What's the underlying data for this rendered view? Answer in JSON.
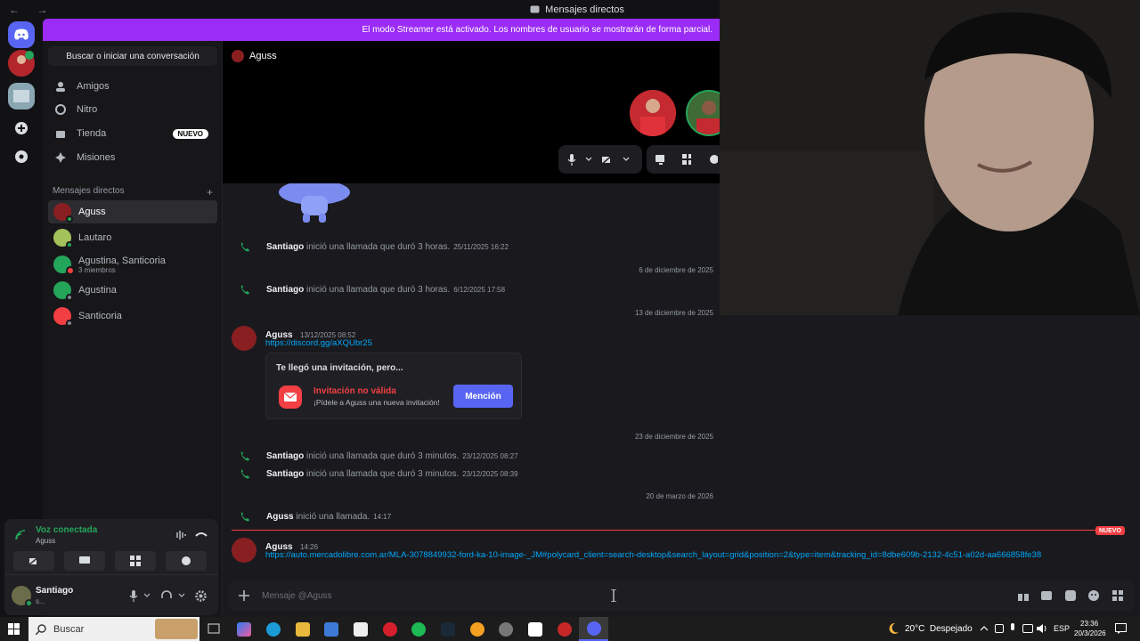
{
  "titlebar": {
    "nav": "← →",
    "title": "Mensajes directos"
  },
  "banner": {
    "text": "El modo Streamer está activado. Los nombres de usuario se mostrarán de forma parcial."
  },
  "sidebar": {
    "search_label": "Buscar o iniciar una conversación",
    "nav": [
      {
        "label": "Amigos",
        "icon": "friends-icon"
      },
      {
        "label": "Nitro",
        "icon": "nitro-icon"
      },
      {
        "label": "Tienda",
        "icon": "shop-icon",
        "badge": "NUEVO"
      },
      {
        "label": "Misiones",
        "icon": "quests-icon"
      }
    ],
    "dm_header": "Mensajes directos",
    "dm_add": "+",
    "dms": [
      {
        "name": "Aguss",
        "sub": ""
      },
      {
        "name": "Lautaro",
        "sub": ""
      },
      {
        "name": "Agustina, Santicoria",
        "sub": "3 miembros"
      },
      {
        "name": "Agustina",
        "sub": ""
      },
      {
        "name": "Santicoria",
        "sub": ""
      }
    ]
  },
  "voice": {
    "status": "Voz conectada",
    "channel": "Aguss"
  },
  "user": {
    "name": "Santiago",
    "status": "s..."
  },
  "stage": {
    "title": "Aguss"
  },
  "chat": {
    "rows": [
      {
        "kind": "call",
        "name": "Santiago",
        "text": "inició una llamada que duró 3 horas.",
        "time": "25/11/2025 16:22"
      },
      {
        "kind": "divider",
        "text": "6 de diciembre de 2025"
      },
      {
        "kind": "call",
        "name": "Santiago",
        "text": "inició una llamada que duró 3 horas.",
        "time": "6/12/2025 17:58"
      },
      {
        "kind": "divider",
        "text": "13 de diciembre de 2025"
      },
      {
        "kind": "divider",
        "text": "23 de diciembre de 2025"
      },
      {
        "kind": "call",
        "name": "Santiago",
        "text": "inició una llamada que duró 3 minutos.",
        "time": "23/12/2025 08:27"
      },
      {
        "kind": "call",
        "name": "Santiago",
        "text": "inició una llamada que duró 3 minutos.",
        "time": "23/12/2025 08:39"
      },
      {
        "kind": "divider",
        "text": "20 de marzo de 2026"
      },
      {
        "kind": "call",
        "name": "Aguss",
        "text": "inició una llamada.",
        "time": "14:17"
      }
    ],
    "invite_msg": {
      "name": "Aguss",
      "time": "13/12/2025 08:52",
      "link": "https://discord.gg/aXQUbr25",
      "card_title": "Te llegó una invitación, pero...",
      "invalid": "Invitación no válida",
      "hint": "¡Pídele a Aguss una nueva invitación!",
      "button": "Mención"
    },
    "new_badge": "NUEVO",
    "last_msg": {
      "name": "Aguss",
      "time": "14:26",
      "link": "https://auto.mercadolibre.com.ar/MLA-3078849932-ford-ka-10-image-_JM#polycard_client=search-desktop&search_layout=grid&position=2&type=item&tracking_id=8dbe609b-2132-4c51-a02d-aa666858fe38"
    }
  },
  "composer": {
    "placeholder": "Mensaje @Aguss"
  },
  "taskbar": {
    "search": "Buscar",
    "weather": "20°C  Despejado",
    "lang": "ESP",
    "time": "23:36",
    "date": "20/3/2026"
  },
  "colors": {
    "accent": "#5865f2",
    "banner": "#9b2cf5",
    "green": "#23a55a",
    "red": "#f23f43"
  }
}
